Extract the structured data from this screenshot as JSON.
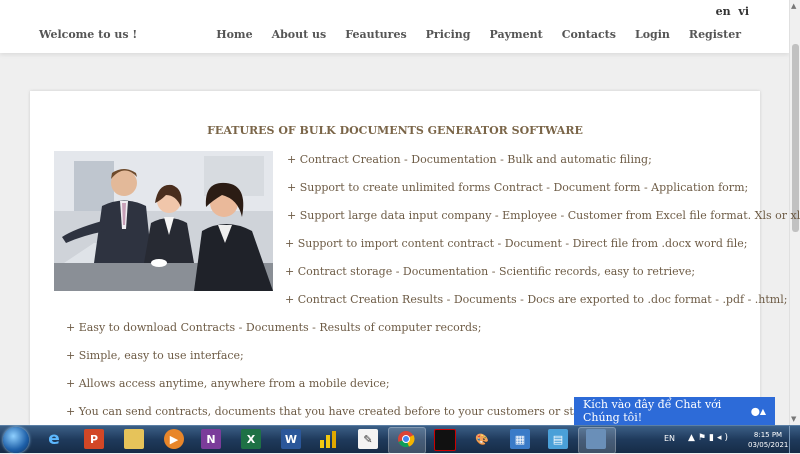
{
  "header": {
    "welcome": "Welcome to us !",
    "lang": [
      "en",
      "vi"
    ],
    "nav": [
      "Home",
      "About us",
      "Feautures",
      "Pricing",
      "Payment",
      "Contacts",
      "Login",
      "Register"
    ]
  },
  "main": {
    "title": "FEATURES OF BULK DOCUMENTS GENERATOR SOFTWARE",
    "features": [
      "+ Contract Creation - Documentation - Bulk and automatic filing;",
      "+ Support to create unlimited forms Contract - Document form - Application form;",
      "+ Support large data input company - Employee - Customer from Excel file format. Xls or xlsx;",
      "+ Support to import content contract - Document - Direct file from .docx word file;",
      "+ Contract storage - Documentation - Scientific records, easy to retrieve;",
      "+ Contract Creation Results - Documents - Docs are exported to .doc format - .pdf - .html;",
      "+ Easy to download Contracts - Documents - Results of computer records;",
      "+ Simple, easy to use interface;",
      "+ Allows access anytime, anywhere from a mobile device;",
      "+ You can send contracts, documents that you have created before to your customers or staffs easily;"
    ]
  },
  "chat": {
    "label": "Kích vào đây để Chat với Chúng tôi!"
  },
  "taskbar": {
    "lang": "EN",
    "time": "8:15 PM",
    "date": "03/05/2021",
    "icons": [
      "ie-icon",
      "powerpoint-icon",
      "file-explorer-icon",
      "media-player-icon",
      "onenote-icon",
      "excel-icon",
      "word-icon",
      "chart-app-icon",
      "notepad-icon",
      "chrome-icon",
      "terminal-icon",
      "paint-icon",
      "book-icon",
      "document-viewer-icon",
      "app-icon"
    ]
  },
  "colors": {
    "accent": "#2d6bd8",
    "text_brown": "#6d5b45",
    "title_brown": "#7a6548"
  }
}
